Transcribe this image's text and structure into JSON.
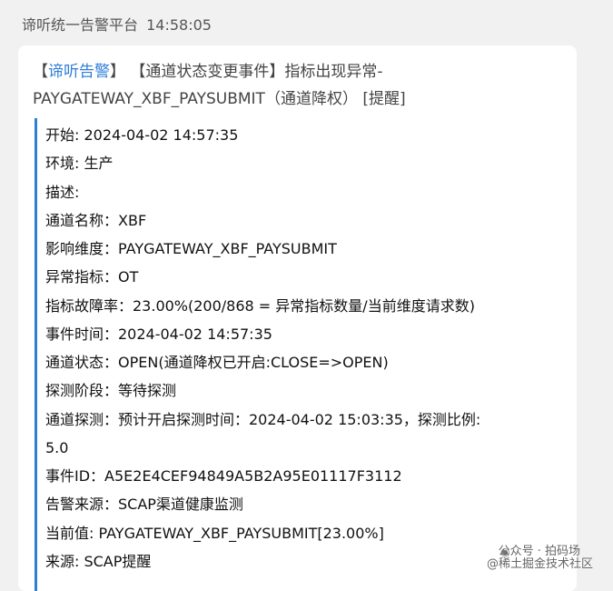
{
  "header": {
    "sender": "谛听统一告警平台",
    "time": "14:58:05"
  },
  "card": {
    "title_prefix_open": "【",
    "title_brand": "谛听告警",
    "title_rest_line1": "】 【通道状态变更事件】指标出现异常-",
    "title_line2": "PAYGATEWAY_XBF_PAYSUBMIT（通道降权） [提醒]",
    "lines": [
      "开始: 2024-04-02 14:57:35",
      "环境: 生产",
      "描述:",
      "通道名称：XBF",
      "影响维度：PAYGATEWAY_XBF_PAYSUBMIT",
      "异常指标：OT",
      "指标故障率：23.00%(200/868 = 异常指标数量/当前维度请求数)",
      "事件时间：2024-04-02 14:57:35",
      "通道状态：OPEN(通道降权已开启:CLOSE=>OPEN)",
      "探测阶段：等待探测",
      "通道探测：预计开启探测时间：2024-04-02 15:03:35，探测比例:",
      "5.0",
      "事件ID：A5E2E4CEF94849A5B2A95E01117F3112",
      "告警来源：SCAP渠道健康监测",
      "当前值: PAYGATEWAY_XBF_PAYSUBMIT[23.00%]",
      "来源: SCAP提醒"
    ]
  },
  "watermark": {
    "account": "公众号 · 拍码场",
    "community": "@稀土掘金技术社区"
  },
  "colors": {
    "accent": "#2f7fd8",
    "background": "#f1f1f1",
    "card": "#ffffff"
  }
}
